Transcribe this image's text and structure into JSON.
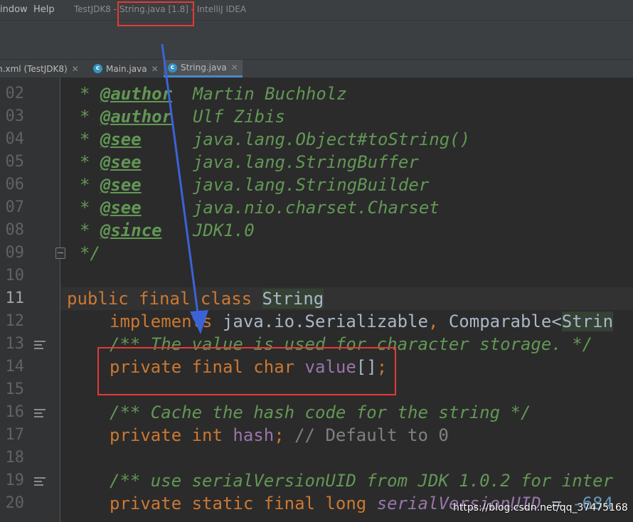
{
  "menu": {
    "window": "indow",
    "help": "Help"
  },
  "window_title": {
    "project": "TestJDK8 -",
    "file": "String.java [1.8]",
    "app": "- IntelliJ IDEA"
  },
  "tabs": [
    {
      "label": "m.xml (TestJDK8)",
      "close": "✕"
    },
    {
      "label": "Main.java",
      "close": "✕"
    },
    {
      "label": "String.java",
      "close": "✕"
    }
  ],
  "line_numbers": [
    "02",
    "03",
    "04",
    "05",
    "06",
    "07",
    "08",
    "09",
    "10",
    "11",
    "12",
    "13",
    "14",
    "15",
    "16",
    "17",
    "18",
    "19",
    "20"
  ],
  "code": {
    "l02": {
      "star": "* ",
      "tag": "@author",
      "text": "  Martin Buchholz"
    },
    "l03": {
      "star": "* ",
      "tag": "@author",
      "text": "  Ulf Zibis"
    },
    "l04": {
      "star": "* ",
      "tag": "@see",
      "text": "     java.lang.Object#toString()"
    },
    "l05": {
      "star": "* ",
      "tag": "@see",
      "text": "     java.lang.StringBuffer"
    },
    "l06": {
      "star": "* ",
      "tag": "@see",
      "text": "     java.lang.StringBuilder"
    },
    "l07": {
      "star": "* ",
      "tag": "@see",
      "text": "     java.nio.charset.Charset"
    },
    "l08": {
      "star": "* ",
      "tag": "@since",
      "text": "   JDK1.0"
    },
    "l09": {
      "text": "*/"
    },
    "l11": {
      "kw": "public final class ",
      "name": "String"
    },
    "l12": {
      "kw": "implements ",
      "text": "java.io.Serializable",
      "comma": ", ",
      "cmp": "Comparable<",
      "cmp_arg": "Strin"
    },
    "l13": {
      "text": "/** The value is used for character storage. */"
    },
    "l14": {
      "kw": "private final char ",
      "field": "value",
      "rest": "[]",
      "semi": ";"
    },
    "l16": {
      "text": "/** Cache the hash code for the string */"
    },
    "l17": {
      "kw": "private int ",
      "field": "hash",
      "semi": "; ",
      "comment": "// Default to 0"
    },
    "l19": {
      "text": "/** use serialVersionUID from JDK 1.0.2 for inter"
    },
    "l20": {
      "kw": "private static final long ",
      "field": "serialVersionUID",
      "eq": " = ",
      "num": "-684"
    }
  },
  "watermark": "https://blog.csdn.net/qq_37475168",
  "colors": {
    "background": "#2b2b2b",
    "keyword": "#cc7832",
    "doc_comment": "#629755",
    "field": "#9876aa",
    "annotation_box": "#e53935",
    "arrow": "#3b63d8"
  }
}
